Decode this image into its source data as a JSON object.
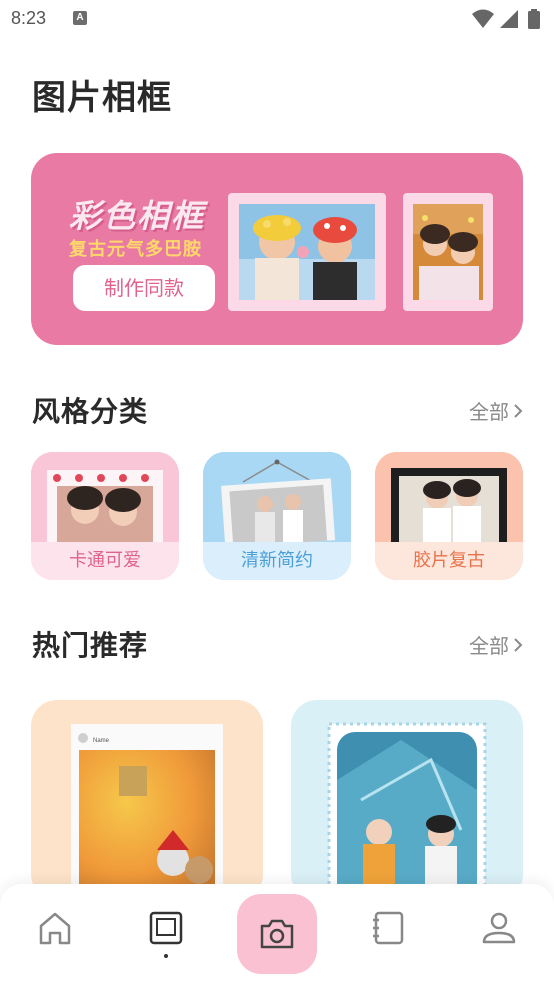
{
  "status_bar": {
    "time": "8:23",
    "notification_icon": "a-icon"
  },
  "page_title": "图片相框",
  "banner": {
    "title": "彩色相框",
    "subtitle": "复古元气多巴胺",
    "button_label": "制作同款",
    "background_color": "#e97aa3"
  },
  "style_section": {
    "title": "风格分类",
    "see_all": "全部",
    "categories": [
      {
        "label": "卡通可爱",
        "label_color": "#e0638e",
        "bg": "#fde3ec"
      },
      {
        "label": "清新简约",
        "label_color": "#4a9fd8",
        "bg": "#dbeefc"
      },
      {
        "label": "胶片复古",
        "label_color": "#e8734a",
        "bg": "#fde6dc"
      }
    ]
  },
  "hot_section": {
    "title": "热门推荐",
    "see_all": "全部",
    "cards": [
      {
        "bg": "#fde3c9",
        "caption": "Name"
      },
      {
        "bg": "#d9f0f6"
      }
    ]
  },
  "bottom_nav": {
    "items": [
      "home-icon",
      "frame-icon",
      "camera-icon",
      "notebook-icon",
      "profile-icon"
    ],
    "active": "frame-icon"
  }
}
